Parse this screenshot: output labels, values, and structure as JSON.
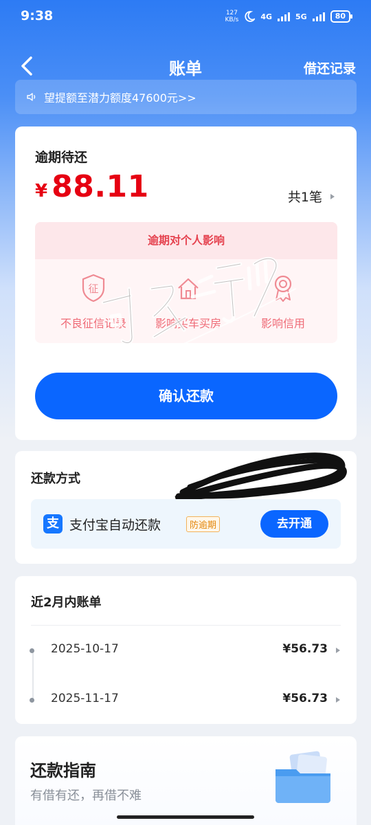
{
  "status": {
    "time": "9:38",
    "net_speed_value": "127",
    "net_speed_unit": "KB/s",
    "net1": "4G",
    "net2": "5G",
    "battery": "80"
  },
  "nav": {
    "title": "账单",
    "record_link": "借还记录"
  },
  "notice": {
    "text": "望提额至潜力额度47600元>>"
  },
  "overdue": {
    "label": "逾期待还",
    "currency": "¥",
    "amount": "88.11",
    "count": "共1笔",
    "impact_title": "逾期对个人影响",
    "impacts": [
      {
        "label": "不良征信记录",
        "icon": "credit-record-shield-icon",
        "glyph": "征"
      },
      {
        "label": "影响买车买房",
        "icon": "house-icon"
      },
      {
        "label": "影响信用",
        "icon": "medal-icon"
      }
    ],
    "confirm_button": "确认还款"
  },
  "method": {
    "label": "还款方式",
    "alipay_text": "支付宝自动还款",
    "badge": "防逾期",
    "open_button": "去开通",
    "alipay_glyph": "支"
  },
  "bills": {
    "title": "近2月内账单",
    "items": [
      {
        "date": "2025-10-17",
        "amount": "¥56.73"
      },
      {
        "date": "2025-11-17",
        "amount": "¥56.73"
      }
    ]
  },
  "guide": {
    "title": "还款指南",
    "subtitle": "有借有还，再借不难"
  },
  "colors": {
    "primary": "#0a66ff",
    "overdue_red": "#e60012",
    "impact_red": "#ef6b77"
  }
}
